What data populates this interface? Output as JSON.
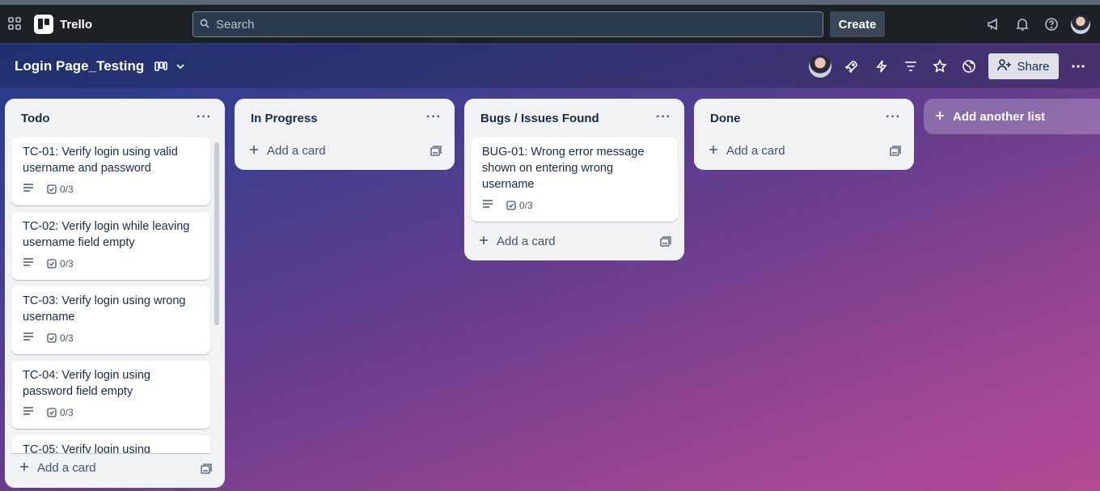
{
  "app": {
    "name": "Trello"
  },
  "topbar": {
    "search_placeholder": "Search",
    "create_label": "Create"
  },
  "board": {
    "title": "Login Page_Testing",
    "share_label": "Share"
  },
  "lists": [
    {
      "title": "Todo",
      "cards": [
        {
          "title": "TC-01: Verify login using valid username and password",
          "checklist": "0/3"
        },
        {
          "title": "TC-02: Verify login while leaving username field empty",
          "checklist": "0/3"
        },
        {
          "title": "TC-03: Verify login using wrong username",
          "checklist": "0/3"
        },
        {
          "title": "TC-04: Verify login using password field empty",
          "checklist": "0/3"
        },
        {
          "title": "TC-05: Verify login using",
          "checklist": ""
        }
      ],
      "add_card_label": "Add a card"
    },
    {
      "title": "In Progress",
      "cards": [],
      "add_card_label": "Add a card"
    },
    {
      "title": "Bugs / Issues Found",
      "cards": [
        {
          "title": "BUG-01: Wrong error message shown on entering wrong username",
          "checklist": "0/3"
        }
      ],
      "add_card_label": "Add a card"
    },
    {
      "title": "Done",
      "cards": [],
      "add_card_label": "Add a card"
    }
  ],
  "add_list_label": "Add another list",
  "icons": {
    "apps": "grid-icon",
    "search": "search-icon",
    "announce": "megaphone-icon",
    "notifications": "bell-icon",
    "help": "help-icon",
    "board_view": "board-view-icon",
    "powerups": "rocket-icon",
    "automation": "lightning-icon",
    "filter": "filter-icon",
    "star": "star-icon",
    "visibility": "globe-icon",
    "more": "more-icon"
  }
}
